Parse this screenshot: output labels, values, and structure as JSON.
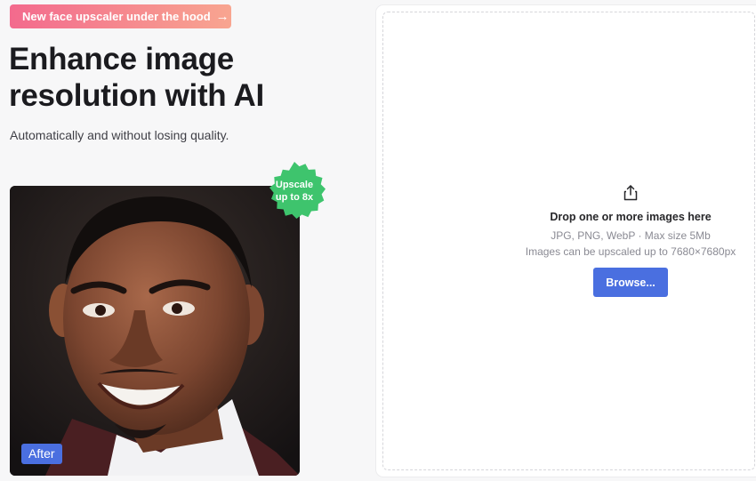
{
  "promo": {
    "text": "New face upscaler under the hood",
    "arrow_icon": "arrow-right-icon",
    "gradient": [
      "#f36a8d",
      "#f8a590"
    ]
  },
  "hero": {
    "title_line1": "Enhance image",
    "title_line2": "resolution with AI",
    "subtitle": "Automatically and without losing quality."
  },
  "preview": {
    "seal_line1": "Upscale",
    "seal_line2": "up to 8x",
    "seal_color": "#3ec46d",
    "after_label": "After"
  },
  "upload": {
    "icon": "upload-share-icon",
    "title": "Drop one or more images here",
    "formats": "JPG, PNG, WebP · Max size 5Mb",
    "limit": "Images can be upscaled up to 7680×7680px",
    "browse_label": "Browse...",
    "accent": "#4a6fe0"
  }
}
